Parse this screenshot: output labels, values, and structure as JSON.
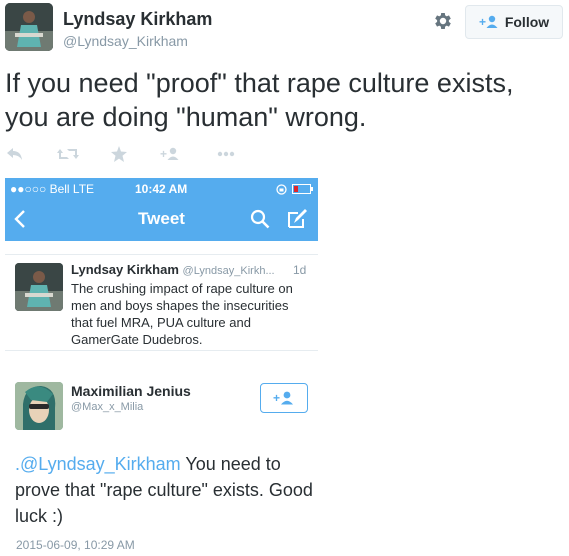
{
  "tweet": {
    "author_name": "Lyndsay Kirkham",
    "author_handle": "@Lyndsay_Kirkham",
    "follow_label": "Follow",
    "text_line1": "If you need \"proof\" that rape culture exists,",
    "text_line2": "you are doing \"human\" wrong.",
    "actions": [
      "reply-icon",
      "retweet-icon",
      "favorite-icon",
      "follow-plus-icon",
      "more-icon"
    ]
  },
  "screenshot": {
    "status": {
      "carrier": "●●○○○ Bell  LTE",
      "time": "10:42 AM"
    },
    "nav_title": "Tweet",
    "quoted": {
      "name": "Lyndsay Kirkham",
      "handle": "@Lyndsay_Kirkh...",
      "time": "1d",
      "text": "The crushing impact of rape culture on men and boys shapes the insecurities that fuel MRA, PUA culture and GamerGate Dudebros."
    },
    "reply": {
      "name": "Maximilian Jenius",
      "handle": "@Max_x_Milia",
      "mention": ".@Lyndsay_Kirkham",
      "text": " You need to prove that \"rape culture\" exists. Good luck :)",
      "date": "2015-06-09, 10:29 AM"
    }
  },
  "colors": {
    "accent": "#55acee",
    "text": "#292f33",
    "muted": "#8899a6"
  }
}
